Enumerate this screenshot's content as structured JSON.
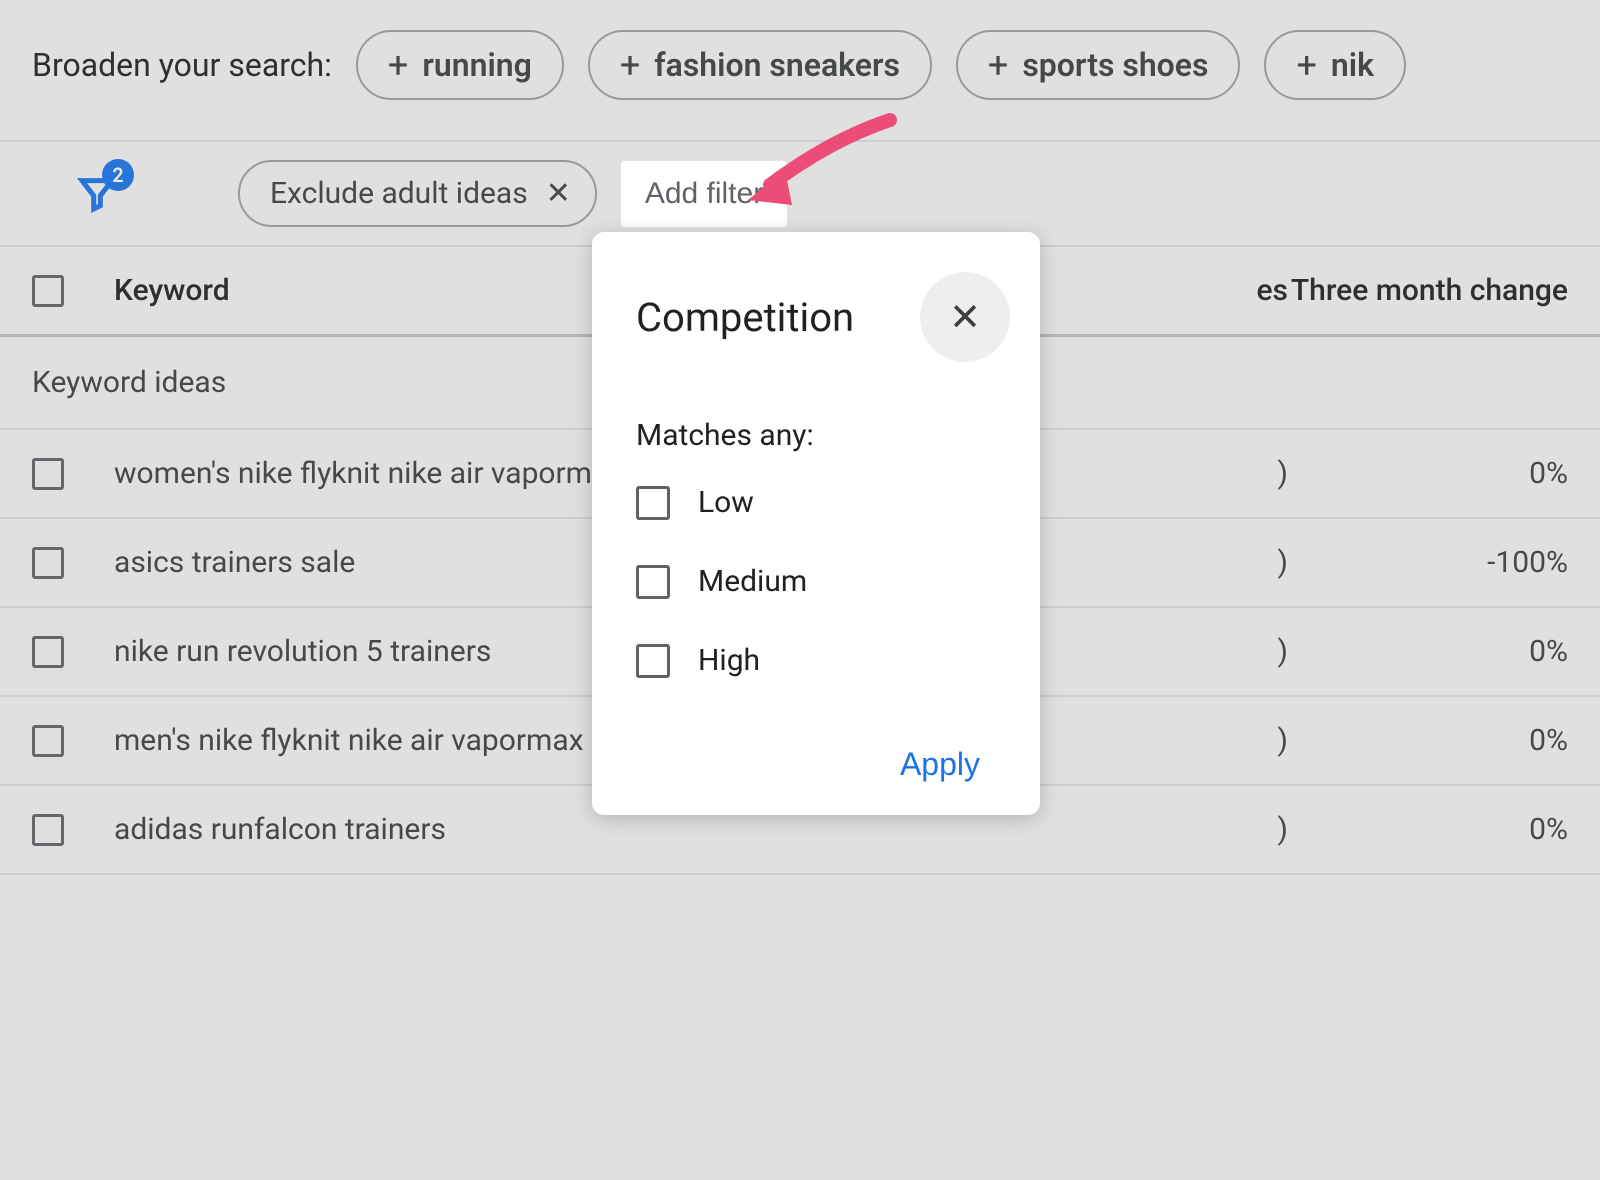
{
  "broaden": {
    "label": "Broaden your search:",
    "chips": [
      "running",
      "fashion sneakers",
      "sports shoes",
      "nik"
    ]
  },
  "filters": {
    "badge_count": "2",
    "chip_label": "Exclude adult ideas",
    "add_filter_label": "Add filter"
  },
  "table": {
    "headers": {
      "keyword": "Keyword",
      "searches_fragment": "es",
      "change": "Three month change"
    },
    "section_label": "Keyword ideas",
    "rows": [
      {
        "keyword": "women's nike flyknit nike air vapormax",
        "searches": ")",
        "change": "0%"
      },
      {
        "keyword": "asics trainers sale",
        "searches": ")",
        "change": "-100%"
      },
      {
        "keyword": "nike run revolution 5 trainers",
        "searches": ")",
        "change": "0%"
      },
      {
        "keyword": "men's nike flyknit nike air vapormax sho",
        "searches": ")",
        "change": "0%"
      },
      {
        "keyword": "adidas runfalcon trainers",
        "searches": ")",
        "change": "0%"
      }
    ]
  },
  "popup": {
    "title": "Competition",
    "matches_label": "Matches any:",
    "options": [
      "Low",
      "Medium",
      "High"
    ],
    "apply_label": "Apply"
  },
  "colors": {
    "accent_blue": "#1a73e8",
    "arrow_pink": "#ec4d78"
  }
}
